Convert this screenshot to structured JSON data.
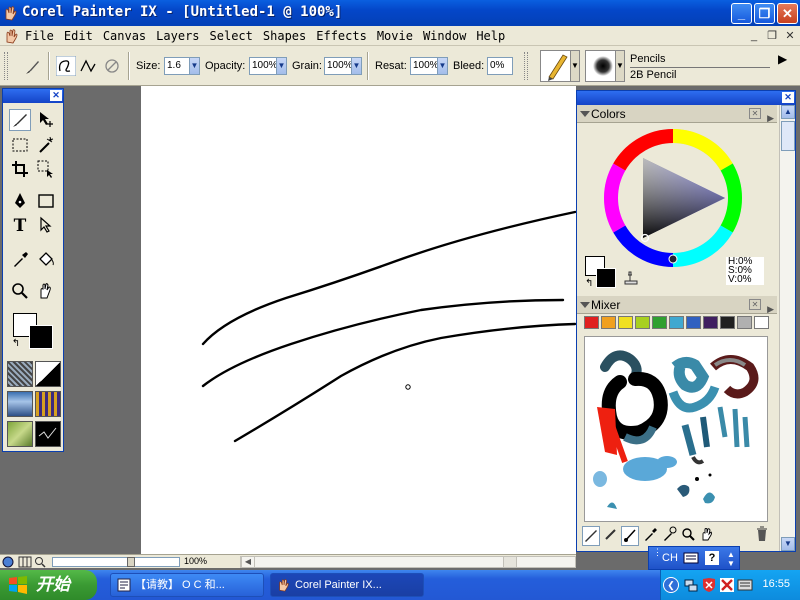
{
  "window": {
    "title": "Corel Painter IX - [Untitled-1 @ 100%]",
    "controls": {
      "minimize": "_",
      "restore": "❐",
      "close": "✕"
    }
  },
  "menu": {
    "items": [
      "File",
      "Edit",
      "Canvas",
      "Layers",
      "Select",
      "Shapes",
      "Effects",
      "Movie",
      "Window",
      "Help"
    ],
    "mdi_controls": [
      "_",
      "❐",
      "✕"
    ]
  },
  "property_bar": {
    "size_label": "Size:",
    "size_value": "1.6",
    "opacity_label": "Opacity:",
    "opacity_value": "100%",
    "grain_label": "Grain:",
    "grain_value": "100%",
    "resat_label": "Resat:",
    "resat_value": "100%",
    "bleed_label": "Bleed:",
    "bleed_value": "0%",
    "brush_category": "Pencils",
    "brush_variant": "2B Pencil"
  },
  "status_bar": {
    "zoom": "100%"
  },
  "colors_palette": {
    "title": "Colors",
    "hsv": {
      "h": "H:0%",
      "s": "S:0%",
      "v": "V:0%"
    }
  },
  "mixer_palette": {
    "title": "Mixer",
    "swatches": [
      "#e02020",
      "#f0a020",
      "#f0e020",
      "#a8d020",
      "#30a030",
      "#40a8d0",
      "#3060c0",
      "#402060",
      "#202020",
      "#b0b0b0",
      "#ffffff"
    ]
  },
  "ime_bar": {
    "lang": "CH"
  },
  "taskbar": {
    "start_label": "开始",
    "tasks": [
      {
        "label": "【请教】 O C 和...",
        "active": false
      },
      {
        "label": "Corel Painter IX...",
        "active": true
      }
    ],
    "clock": "16:55"
  },
  "colors": {
    "titlebar": "#0446c8",
    "chrome": "#ece9d8",
    "workspace": "#6b6b6b"
  }
}
